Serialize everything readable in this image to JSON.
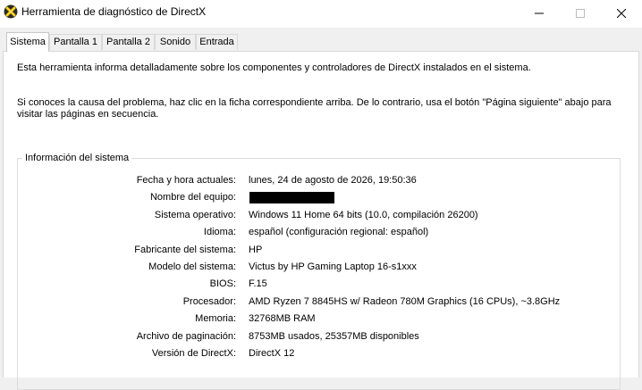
{
  "window": {
    "title": "Herramienta de diagnóstico de DirectX",
    "controls": {
      "minimize_icon": "minimize-icon",
      "maximize_icon": "maximize-icon",
      "close_icon": "close-icon"
    }
  },
  "tabs": [
    {
      "label": "Sistema",
      "active": true
    },
    {
      "label": "Pantalla 1",
      "active": false
    },
    {
      "label": "Pantalla 2",
      "active": false
    },
    {
      "label": "Sonido",
      "active": false
    },
    {
      "label": "Entrada",
      "active": false
    }
  ],
  "intro": {
    "p1": "Esta herramienta informa detalladamente sobre los componentes y controladores de DirectX instalados en el sistema.",
    "p2": "Si conoces la causa del problema, haz clic en la ficha correspondiente arriba. De lo contrario, usa el botón \"Página siguiente\" abajo para visitar las páginas en secuencia."
  },
  "system_info": {
    "title": "Información del sistema",
    "rows": [
      {
        "label": "Fecha y hora actuales:",
        "value": "lunes, 24 de agosto de 2026, 19:50:36"
      },
      {
        "label": "Nombre del equipo:",
        "value": "",
        "redacted": true
      },
      {
        "label": "Sistema operativo:",
        "value": "Windows 11 Home 64 bits (10.0, compilación 26200)"
      },
      {
        "label": "Idioma:",
        "value": "español (configuración regional: español)"
      },
      {
        "label": "Fabricante del sistema:",
        "value": "HP"
      },
      {
        "label": "Modelo del sistema:",
        "value": "Victus by HP Gaming Laptop 16-s1xxx"
      },
      {
        "label": "BIOS:",
        "value": "F.15"
      },
      {
        "label": "Procesador:",
        "value": "AMD Ryzen 7 8845HS w/ Radeon 780M Graphics (16 CPUs), ~3.8GHz"
      },
      {
        "label": "Memoria:",
        "value": "32768MB RAM"
      },
      {
        "label": "Archivo de paginación:",
        "value": "8753MB usados, 25357MB disponibles"
      },
      {
        "label": "Versión de DirectX:",
        "value": "DirectX 12"
      }
    ]
  }
}
